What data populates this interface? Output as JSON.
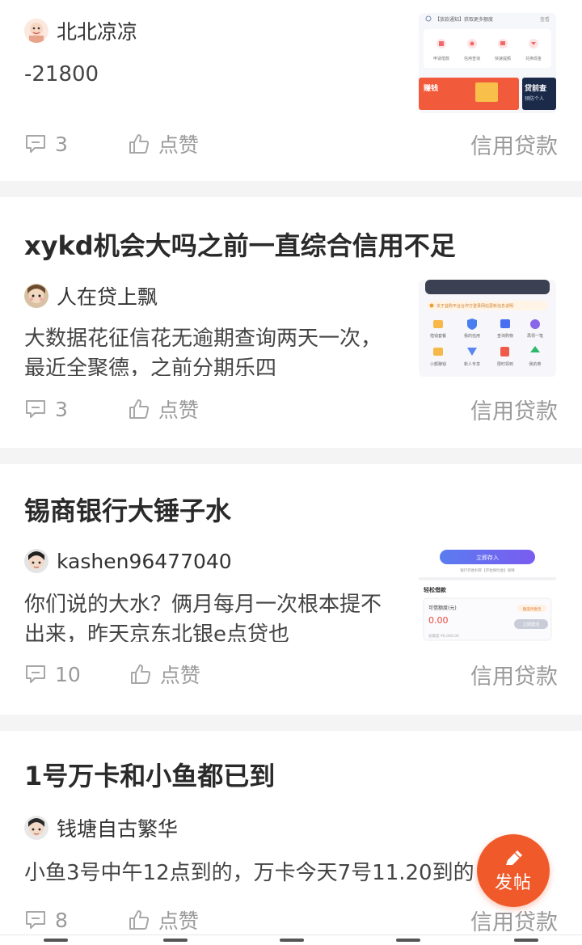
{
  "posts": [
    {
      "title": "",
      "author": "北北凉凉",
      "body": "-21800",
      "comments": "3",
      "like_label": "点赞",
      "category": "信用贷款"
    },
    {
      "title": "xykd机会大吗之前一直综合信用不足",
      "author": "人在贷上飘",
      "body": "大数据花征信花无逾期查询两天一次，最近全聚德，之前分期乐四",
      "comments": "3",
      "like_label": "点赞",
      "category": "信用贷款"
    },
    {
      "title": "锡商银行大锤子水",
      "author": "kashen96477040",
      "body": "你们说的大水？俩月每月一次根本提不出来，昨天京东北银e点贷也",
      "comments": "10",
      "like_label": "点赞",
      "category": "信用贷款"
    },
    {
      "title": "1号万卡和小鱼都已到",
      "author": "钱塘自古繁华",
      "body": "小鱼3号中午12点到的，万卡今天7号11.20到的",
      "comments": "8",
      "like_label": "点赞",
      "category": "信用贷款"
    }
  ],
  "thumbs": {
    "t1": {
      "notice": "【放款通知】获取更多额度",
      "more": "查看",
      "icons": [
        "申请借款",
        "信用查询",
        "快速提额",
        "兑换现金"
      ],
      "banner_left": "赚钱",
      "banner_right": "贷前查",
      "banner_sub": "预防个人"
    },
    "t2": {
      "notice": "关于益购平台合作方登录网站更新信息说明",
      "icons_row1": [
        "借钱套餐",
        "我的信用",
        "查询购物",
        "再领一笔"
      ],
      "icons_row2": [
        "小额赚钱",
        "新人专享",
        "限时领到",
        "我的券"
      ]
    },
    "t3": {
      "button": "立即存入",
      "sub": "银行存款利率【存款保险金】保障",
      "section": "轻松借款",
      "label": "可借额度(元)",
      "amount": "0.00",
      "tag": "额度待激活",
      "btn2": "立即激活",
      "limit": "总额度 ¥6,000.00"
    }
  },
  "fab": {
    "label": "发帖"
  },
  "colors": {
    "accent": "#f05a2a",
    "meta_gray": "#9a9a9a",
    "title": "#2a2a2a"
  }
}
